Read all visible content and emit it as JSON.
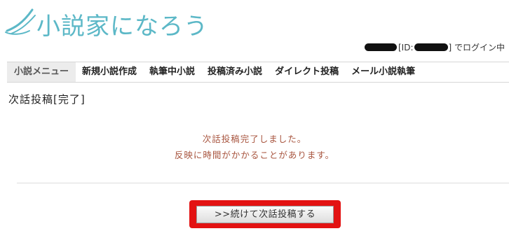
{
  "header": {
    "logo_text": "小説家になろう"
  },
  "login": {
    "id_prefix": "[ID:",
    "id_suffix": "] でログイン中"
  },
  "menu": {
    "items": [
      {
        "label": "小説メニュー"
      },
      {
        "label": "新規小説作成"
      },
      {
        "label": "執筆中小説"
      },
      {
        "label": "投稿済み小説"
      },
      {
        "label": "ダイレクト投稿"
      },
      {
        "label": "メール小説執筆"
      }
    ]
  },
  "page": {
    "title": "次話投稿[完了]",
    "message_line1": "次話投稿完了しました。",
    "message_line2": "反映に時間がかかることがあります。",
    "continue_button": ">>続けて次話投稿する"
  },
  "colors": {
    "logo": "#5cb8c7",
    "message": "#a8553f",
    "highlight": "#e31212"
  }
}
